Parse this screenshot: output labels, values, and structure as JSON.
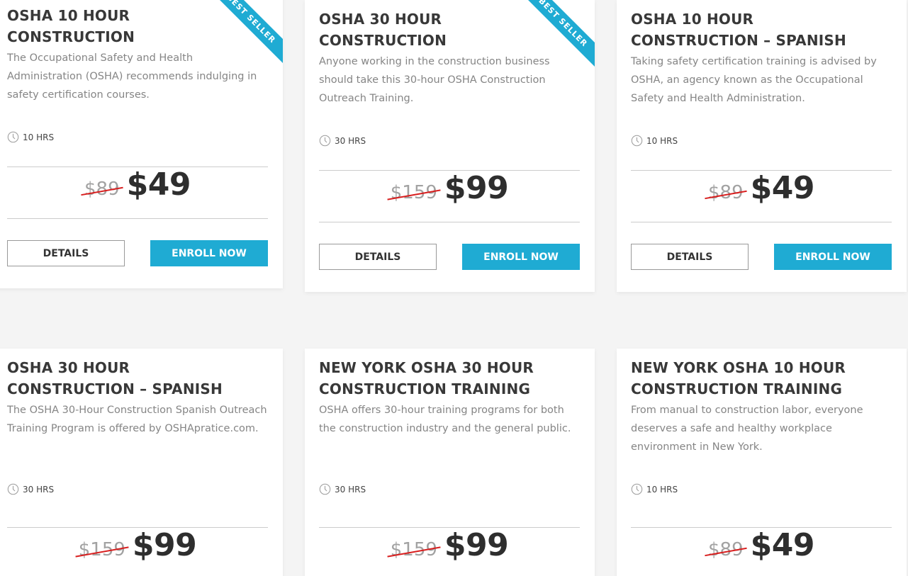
{
  "colors": {
    "accent": "#1fabd3",
    "strike": "#d81f1f",
    "title": "#383838",
    "text": "#858585"
  },
  "icons": {
    "clock": "clock-icon"
  },
  "courses": [
    {
      "title": "OSHA 10 HOUR CONSTRUCTION",
      "description": "The Occupational Safety and Health Administration (OSHA) recommends indulging in safety certification courses.",
      "hours": "10 HRS",
      "old_price": "$89",
      "price": "$49",
      "badge": "BEST SELLER",
      "details_label": "DETAILS",
      "enroll_label": "ENROLL NOW"
    },
    {
      "title": "OSHA 30 HOUR CONSTRUCTION",
      "description": "Anyone working in the construction business should take this 30-hour OSHA Construction Outreach Training.",
      "hours": "30 HRS",
      "old_price": "$159",
      "price": "$99",
      "badge": "BEST SELLER",
      "details_label": "DETAILS",
      "enroll_label": "ENROLL NOW"
    },
    {
      "title": "OSHA 10 HOUR CONSTRUCTION – SPANISH",
      "description": "Taking safety certification training is advised by OSHA, an agency known as the Occupational Safety and Health Administration.",
      "hours": "10 HRS",
      "old_price": "$89",
      "price": "$49",
      "details_label": "DETAILS",
      "enroll_label": "ENROLL NOW"
    },
    {
      "title": "OSHA 30 HOUR CONSTRUCTION – SPANISH",
      "description": "The OSHA 30-Hour Construction Spanish Outreach Training Program is offered by OSHApratice.com.",
      "hours": "30 HRS",
      "old_price": "$159",
      "price": "$99"
    },
    {
      "title": "NEW YORK OSHA 30 HOUR CONSTRUCTION TRAINING",
      "description": "OSHA offers 30-hour training programs for both the construction industry and the general public.",
      "hours": "30 HRS",
      "old_price": "$159",
      "price": "$99"
    },
    {
      "title": "NEW YORK OSHA 10 HOUR CONSTRUCTION TRAINING",
      "description": "From manual to construction labor, everyone deserves a safe and healthy workplace environment in New York.",
      "hours": "10 HRS",
      "old_price": "$89",
      "price": "$49"
    }
  ]
}
